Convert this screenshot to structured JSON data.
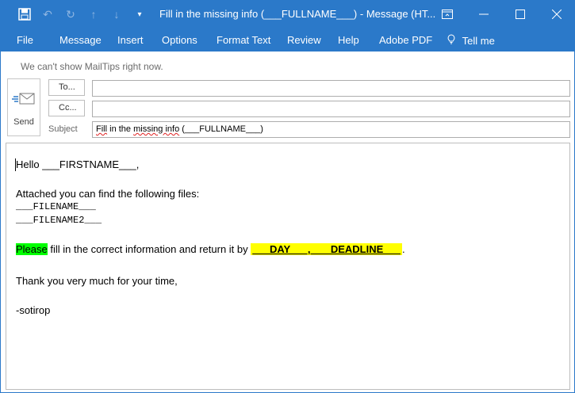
{
  "window": {
    "title": "Fill in the missing info (___FULLNAME___)  -  Message (HT..."
  },
  "toolbar": {
    "save_icon": "save-icon",
    "undo_icon": "undo-icon",
    "redo_icon": "redo-icon",
    "up_icon": "arrow-up-icon",
    "down_icon": "arrow-down-icon",
    "more_icon": "customize-qat-icon"
  },
  "ribbon": {
    "tabs": [
      "File",
      "Message",
      "Insert",
      "Options",
      "Format Text",
      "Review",
      "Help",
      "Adobe PDF",
      "Tell me"
    ]
  },
  "header": {
    "mailtips": "We can't show MailTips right now.",
    "send_label": "Send",
    "to_label": "To...",
    "cc_label": "Cc...",
    "to_value": "",
    "cc_value": "",
    "subject_label": "Subject",
    "subject_word1": "Fill",
    "subject_word2": "in the",
    "subject_word3": "missing info",
    "subject_rest": "(___FULLNAME___)"
  },
  "body": {
    "greeting": "Hello ___FIRSTNAME___,",
    "attached": "Attached you can find the following files:",
    "file1": "___FILENAME___",
    "file2": "___FILENAME2___",
    "please": "Please",
    "instruction": " fill in the correct information and return it by ",
    "deadline": "___DAY___, ___DEADLINE___",
    "period": ".",
    "thanks": "Thank you very much for your time,",
    "signature": "-sotirop"
  },
  "colors": {
    "accent": "#2b79c9",
    "highlight_green": "#00ff00",
    "highlight_yellow": "#ffff00"
  }
}
